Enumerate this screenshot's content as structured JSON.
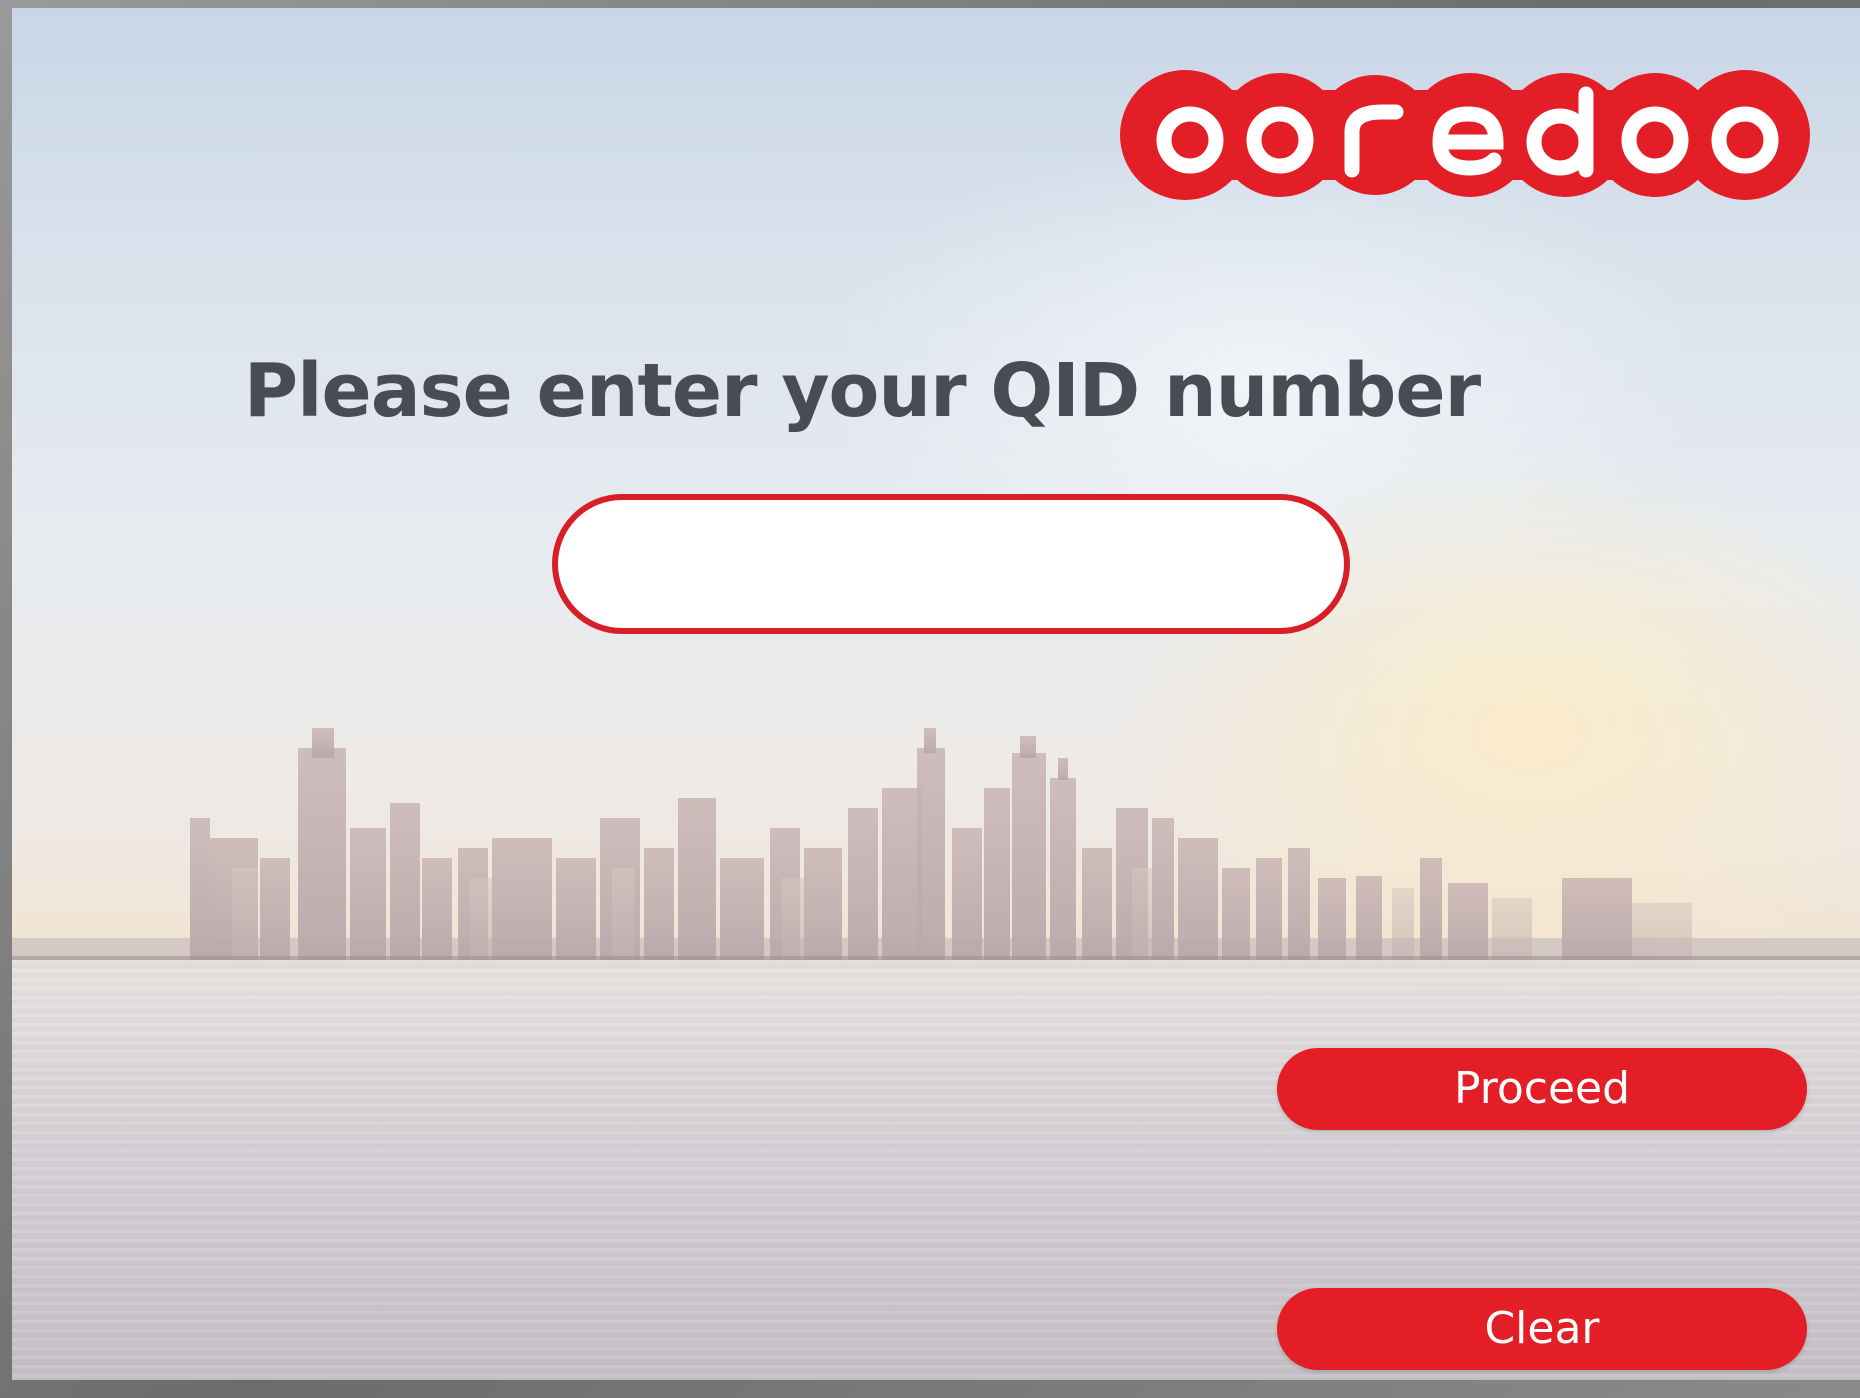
{
  "brand": {
    "logo_text": "ooredoo",
    "accent_color": "#e41e26"
  },
  "form": {
    "heading": "Please enter your QID number",
    "qid_value": "",
    "qid_placeholder": ""
  },
  "actions": {
    "proceed_label": "Proceed",
    "clear_label": "Clear"
  },
  "background": {
    "scene": "city-skyline-waterfront-photo"
  }
}
